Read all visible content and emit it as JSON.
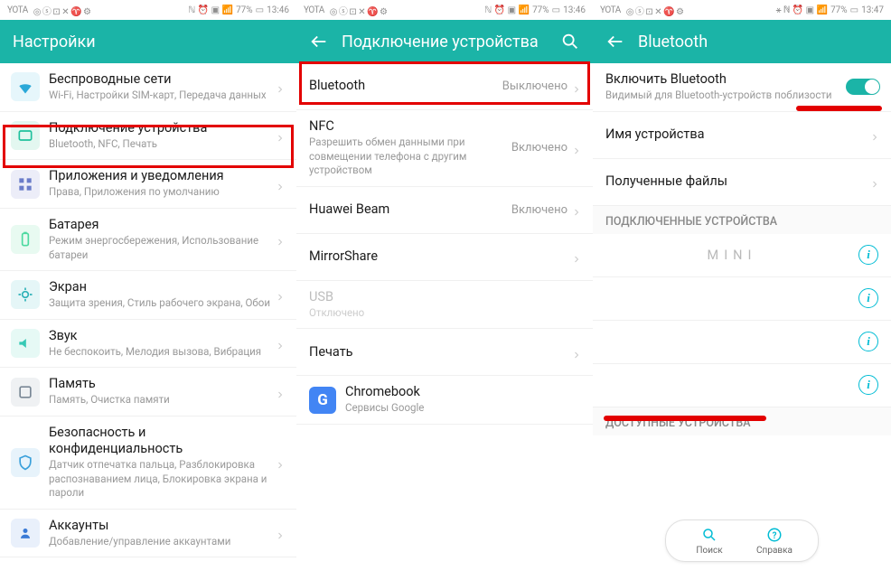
{
  "statusbar": {
    "carrier": "YOTA",
    "battery": "77%",
    "time1": "13:46",
    "time2": "13:46",
    "time3": "13:47",
    "icons": "◎ ⓢ ⊡ ✕ ♈ ⚙"
  },
  "pane1": {
    "title": "Настройки",
    "items": [
      {
        "title": "Беспроводные сети",
        "sub": "Wi-Fi, Настройки SIM-карт, Передача данных",
        "color": "#2aa8d8"
      },
      {
        "title": "Подключение устройства",
        "sub": "Bluetooth, NFC, Печать",
        "color": "#1fc19c"
      },
      {
        "title": "Приложения и уведомления",
        "sub": "Права, Приложения по умолчанию",
        "color": "#6a7cc9"
      },
      {
        "title": "Батарея",
        "sub": "Режим энергосбережения, Использование батареи",
        "color": "#4cd9a0"
      },
      {
        "title": "Экран",
        "sub": "Защита зрения, Стиль рабочего экрана, Обои",
        "color": "#2fb2b8"
      },
      {
        "title": "Звук",
        "sub": "Не беспокоить, Мелодия вызова, Вибрация",
        "color": "#37c9b5"
      },
      {
        "title": "Память",
        "sub": "Память, Очистка памяти",
        "color": "#7a8896"
      },
      {
        "title": "Безопасность и конфиденциальность",
        "sub": "Датчик отпечатка пальца, Разблокировка распознаванием лица, Блокировка экрана и пароли",
        "color": "#3aa0db"
      },
      {
        "title": "Аккаунты",
        "sub": "Добавление/управление аккаунтами",
        "color": "#3b7bd6"
      }
    ]
  },
  "pane2": {
    "title": "Подключение устройства",
    "items": [
      {
        "title": "Bluetooth",
        "value": "Выключено"
      },
      {
        "title": "NFC",
        "sub": "Разрешить обмен данными при совмещении телефона с другим устройством",
        "value": "Включено"
      },
      {
        "title": "Huawei Beam",
        "value": "Включено"
      },
      {
        "title": "MirrorShare"
      },
      {
        "title": "USB",
        "sub": "Отключено",
        "muted": true
      },
      {
        "title": "Печать"
      },
      {
        "title": "Chromebook",
        "sub": "Сервисы Google",
        "gicon": true
      }
    ]
  },
  "pane3": {
    "title": "Bluetooth",
    "enable_title": "Включить Bluetooth",
    "enable_sub": "Видимый для Bluetooth-устройств поблизости",
    "device_name": "Имя устройства",
    "received_files": "Полученные файлы",
    "section_connected": "ПОДКЛЮЧЕННЫЕ УСТРОЙСТВА",
    "section_available": "ДОСТУПНЫЕ УСТРОЙСТВА",
    "devices": [
      {
        "name": "MINI"
      },
      {
        "name": " "
      },
      {
        "name": " "
      },
      {
        "name": " "
      }
    ],
    "btn_search": "Поиск",
    "btn_help": "Справка"
  }
}
